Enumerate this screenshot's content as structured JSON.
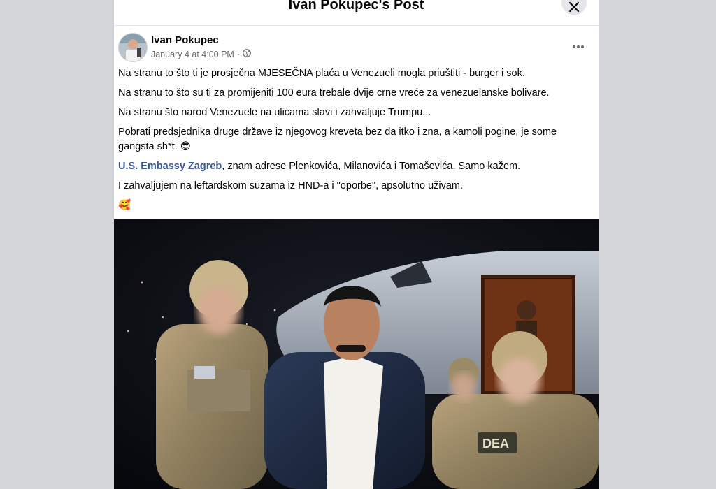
{
  "dialog": {
    "title": "Ivan Pokupec's Post"
  },
  "post": {
    "author": "Ivan Pokupec",
    "timestamp": "January 4 at 4:00 PM",
    "separator": "·",
    "privacy_icon": "globe-icon",
    "paragraphs": [
      "Na stranu to što ti je prosječna MJESEČNA plaća u Venezueli mogla priuštiti - burger i sok.",
      "Na stranu to što su ti za promijeniti 100 eura trebale dvije crne vreće za venezuelanske bolivare.",
      "Na stranu što narod Venezuele na ulicama slavi i zahvaljuje Trumpu...",
      "Pobrati predsjednika druge države iz njegovog kreveta bez da itko i zna, a kamoli pogine, je some gangsta sh*t."
    ],
    "emoji_cool": "😎",
    "mention": "U.S. Embassy Zagreb",
    "mention_rest": ", znam adrese Plenkovića, Milanovića i Tomaševića. Samo kažem.",
    "last_paragraph": "I zahvaljujem na leftardskom suzama iz HND-a i \"oporbe\", apsolutno uživam.",
    "emoji_love": "🥰"
  },
  "image": {
    "patch_text": "DEA"
  },
  "colors": {
    "link": "#385898",
    "meta": "#65676b",
    "backdrop": "#d4d5d8"
  }
}
